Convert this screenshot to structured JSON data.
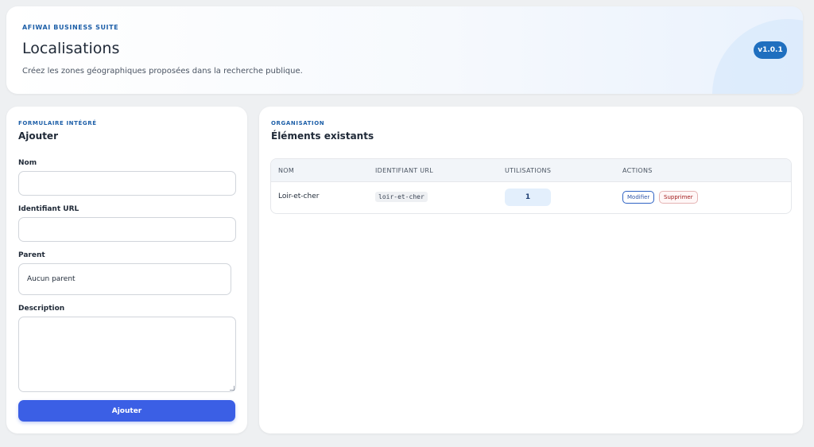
{
  "header": {
    "eyebrow": "AFIWAI BUSINESS SUITE",
    "title": "Localisations",
    "subtitle": "Créez les zones géographiques proposées dans la recherche publique.",
    "version": "v1.0.1"
  },
  "form": {
    "eyebrow": "FORMULAIRE INTÉGRÉ",
    "title": "Ajouter",
    "fields": {
      "name_label": "Nom",
      "name_value": "",
      "slug_label": "Identifiant URL",
      "slug_value": "",
      "parent_label": "Parent",
      "parent_selected": "Aucun parent",
      "description_label": "Description",
      "description_value": ""
    },
    "submit_label": "Ajouter"
  },
  "list": {
    "eyebrow": "ORGANISATION",
    "title": "Éléments existants",
    "columns": [
      "NOM",
      "IDENTIFIANT URL",
      "UTILISATIONS",
      "ACTIONS"
    ],
    "rows": [
      {
        "name": "Loir-et-cher",
        "slug": "loir-et-cher",
        "usage": "1",
        "edit_label": "Modifier",
        "delete_label": "Supprimer"
      }
    ]
  },
  "colors": {
    "accent": "#3b5fe5",
    "brand": "#1d5fa8",
    "badge": "#1f6fbf",
    "danger": "#a11b1b"
  }
}
